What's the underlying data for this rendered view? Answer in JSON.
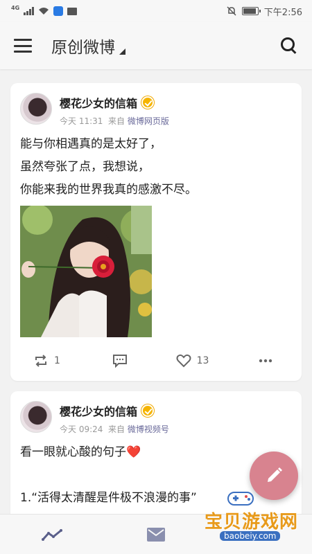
{
  "status_bar": {
    "network": "4G",
    "time": "下午2:56"
  },
  "app_bar": {
    "title": "原创微博"
  },
  "posts": [
    {
      "author": "樱花少女的信箱",
      "time": "今天 11:31",
      "source_prefix": "来自",
      "source": "微博网页版",
      "lines": [
        "能与你相遇真的是太好了，",
        "虽然夸张了点，我想说，",
        "你能来我的世界我真的感激不尽。"
      ],
      "reposts": "1",
      "likes": "13"
    },
    {
      "author": "樱花少女的信箱",
      "time": "今天 09:24",
      "source_prefix": "来自",
      "source": "微博视频号",
      "lines": [
        "看一眼就心酸的句子❤️",
        "",
        "1.“活得太清醒是件极不浪漫的事”"
      ]
    }
  ],
  "bottom_nav": {
    "icons": [
      "trend-icon",
      "mail-icon"
    ]
  },
  "watermark": {
    "text": "宝贝游戏网",
    "url": "baobeiy.com"
  },
  "colors": {
    "fab": "#d8838f",
    "verified": "#f5b400",
    "source_link": "#6a6a9a"
  }
}
